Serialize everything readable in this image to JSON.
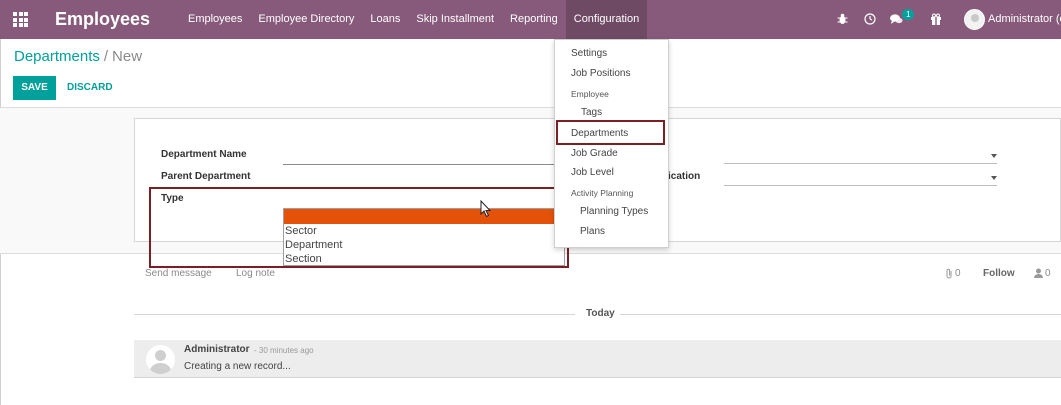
{
  "app": {
    "title": "Employees"
  },
  "menu": {
    "items": [
      {
        "label": "Employees"
      },
      {
        "label": "Employee Directory"
      },
      {
        "label": "Loans"
      },
      {
        "label": "Skip Installment"
      },
      {
        "label": "Reporting"
      },
      {
        "label": "Configuration"
      }
    ],
    "active": "Configuration"
  },
  "systray": {
    "icons": [
      "bug-icon",
      "clock-icon",
      "chat-icon",
      "gift-icon"
    ],
    "chat_badge": "1",
    "user_name": "Administrator (c"
  },
  "breadcrumb": {
    "parent": "Departments",
    "separator": "/",
    "current": "New"
  },
  "buttons": {
    "save": "SAVE",
    "discard": "DISCARD"
  },
  "form": {
    "department_name_label": "Department Name",
    "parent_department_label": "Parent Department",
    "type_label": "Type",
    "partial_label": "ication",
    "type_options": [
      "Sector",
      "Department",
      "Section"
    ]
  },
  "config_menu": {
    "items": [
      {
        "label": "Settings",
        "kind": "item"
      },
      {
        "label": "Job Positions",
        "kind": "item"
      },
      {
        "label": "Employee",
        "kind": "header"
      },
      {
        "label": "Tags",
        "kind": "sub"
      },
      {
        "label": "Departments",
        "kind": "item",
        "highlighted": true
      },
      {
        "label": "Job Grade",
        "kind": "item"
      },
      {
        "label": "Job Level",
        "kind": "item"
      },
      {
        "label": "Activity Planning",
        "kind": "header"
      },
      {
        "label": "Planning Types",
        "kind": "sub"
      },
      {
        "label": "Plans",
        "kind": "sub"
      }
    ]
  },
  "chatter": {
    "send_message": "Send message",
    "log_note": "Log note",
    "attachments_count": "0",
    "follow": "Follow",
    "followers_count": "0",
    "today": "Today",
    "message": {
      "author": "Administrator",
      "time": "- 30 minutes ago",
      "body": "Creating a new record..."
    }
  },
  "colors": {
    "navbar": "#875a7b",
    "accent": "#00a09d",
    "dropdown_selected": "#e4520a",
    "annotation_border": "#7a1f23"
  }
}
